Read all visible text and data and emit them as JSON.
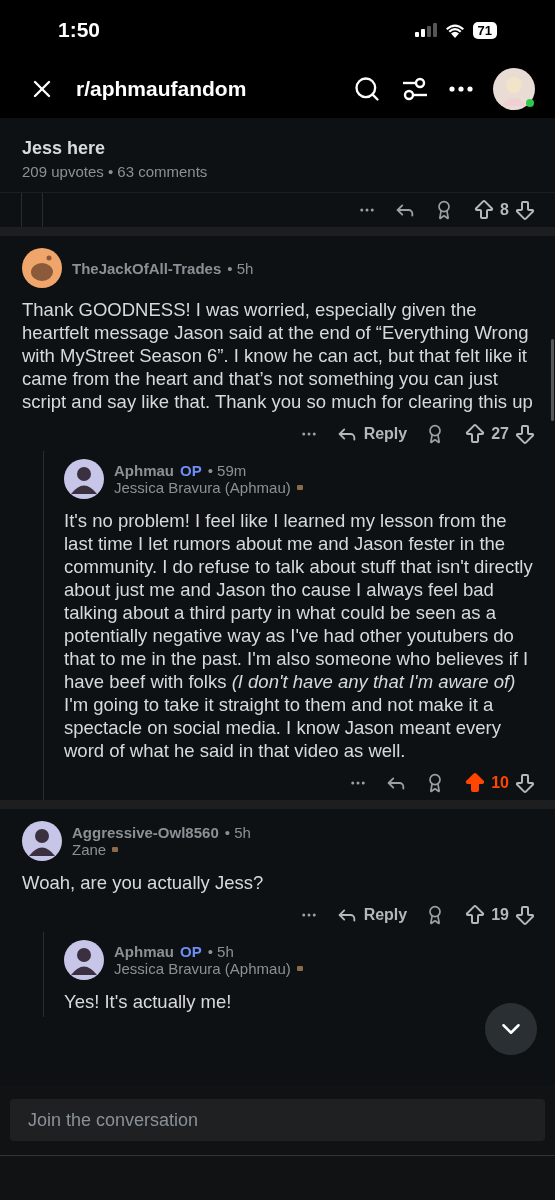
{
  "status_bar": {
    "time": "1:50",
    "battery": "71"
  },
  "header": {
    "subreddit": "r/aphmaufandom",
    "online": true
  },
  "post": {
    "title": "Jess here",
    "meta": "209 upvotes • 63 comments"
  },
  "previous_actions": {
    "score": "8",
    "upvoted": false
  },
  "comments": [
    {
      "author": "TheJackOfAll-Trades",
      "avatar": {
        "kind": "snoo"
      },
      "time": "• 5h",
      "body": "Thank GOODNESS! I was worried, especially given the heartfelt message Jason said at the end of “Everything Wrong with MyStreet Season 6”. I know he can act, but that felt like it came from the heart and that’s not something you can just script and say like that. Thank you so much for clearing this up",
      "actions": {
        "reply_label": "Reply",
        "score": "27",
        "upvoted": false
      },
      "children": [
        {
          "author": "Aphmau",
          "badge": "OP",
          "avatar": {
            "kind": "photo"
          },
          "time": "• 59m",
          "flair": "Jessica Bravura (Aphmau)",
          "body": "It's no problem! I feel like I learned my lesson from the last time I let rumors about me and Jason fester in the community. I do refuse to talk about stuff that isn't directly about just me and Jason tho cause I always feel bad talking about a third party in what could be seen as a potentially negative way as I've had other youtubers do that to me in the past. I'm also someone who believes if I have beef with folks *(I don't have any that I'm aware of)* I'm going to take it straight to them and not make it a spectacle on social media. I know Jason meant every word of what he said in that video as well.",
          "actions": {
            "score": "10",
            "upvoted": true
          }
        }
      ]
    },
    {
      "author": "Aggressive-Owl8560",
      "avatar": {
        "kind": "photo"
      },
      "time": "• 5h",
      "flair": "Zane",
      "body": "Woah, are you actually Jess?",
      "actions": {
        "reply_label": "Reply",
        "score": "19",
        "upvoted": false
      },
      "children": [
        {
          "author": "Aphmau",
          "badge": "OP",
          "avatar": {
            "kind": "photo"
          },
          "time": "• 5h",
          "flair": "Jessica Bravura (Aphmau)",
          "body": "Yes! It's actually me!"
        }
      ]
    }
  ],
  "composer": {
    "placeholder": "Join the conversation"
  }
}
